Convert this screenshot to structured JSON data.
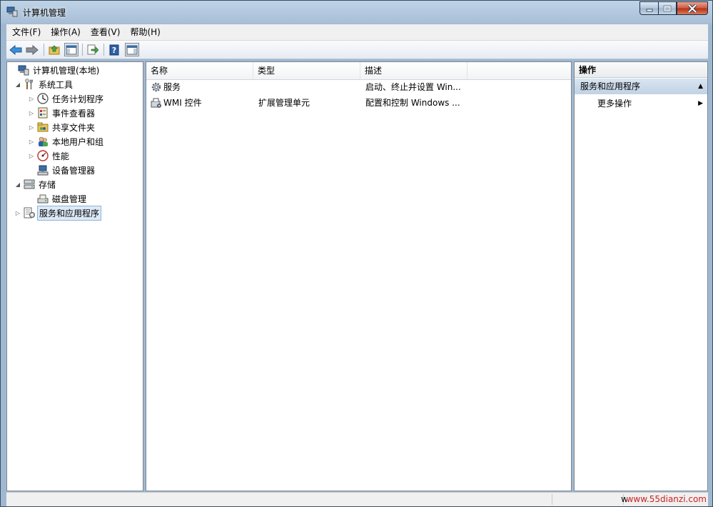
{
  "window": {
    "title": "计算机管理"
  },
  "menu": [
    "文件(F)",
    "操作(A)",
    "查看(V)",
    "帮助(H)"
  ],
  "toolbar": {
    "icons": [
      "back-arrow-icon",
      "forward-arrow-icon",
      "up-folder-icon",
      "show-hide-console-tree-icon",
      "export-list-icon",
      "help-icon",
      "show-hide-action-pane-icon"
    ]
  },
  "tree": {
    "items": [
      {
        "label": "计算机管理(本地)",
        "icon": "computer-management-icon",
        "level": 0,
        "expander": ""
      },
      {
        "label": "系统工具",
        "icon": "system-tools-icon",
        "level": 1,
        "expander": "expanded"
      },
      {
        "label": "任务计划程序",
        "icon": "clock-icon",
        "level": 2,
        "expander": "collapsed"
      },
      {
        "label": "事件查看器",
        "icon": "event-viewer-icon",
        "level": 2,
        "expander": "collapsed"
      },
      {
        "label": "共享文件夹",
        "icon": "shared-folder-icon",
        "level": 2,
        "expander": "collapsed"
      },
      {
        "label": "本地用户和组",
        "icon": "users-icon",
        "level": 2,
        "expander": "collapsed"
      },
      {
        "label": "性能",
        "icon": "performance-icon",
        "level": 2,
        "expander": "collapsed"
      },
      {
        "label": "设备管理器",
        "icon": "device-manager-icon",
        "level": 2,
        "expander": ""
      },
      {
        "label": "存储",
        "icon": "storage-icon",
        "level": 1,
        "expander": "expanded"
      },
      {
        "label": "磁盘管理",
        "icon": "disk-management-icon",
        "level": 2,
        "expander": ""
      },
      {
        "label": "服务和应用程序",
        "icon": "services-apps-icon",
        "level": 1,
        "expander": "collapsed",
        "selected": true
      }
    ]
  },
  "list": {
    "columns": [
      "名称",
      "类型",
      "描述"
    ],
    "rows": [
      {
        "name": "服务",
        "type": "",
        "description": "启动、终止并设置 Win...",
        "icon": "gear-icon"
      },
      {
        "name": "WMI 控件",
        "type": "扩展管理单元",
        "description": "配置和控制 Windows ...",
        "icon": "wmi-control-icon"
      }
    ]
  },
  "actions": {
    "header": "操作",
    "section": "服务和应用程序",
    "items": [
      "更多操作"
    ]
  },
  "status": {
    "watermark_prefix": "w",
    "watermark": "www.55dianzi.com"
  }
}
